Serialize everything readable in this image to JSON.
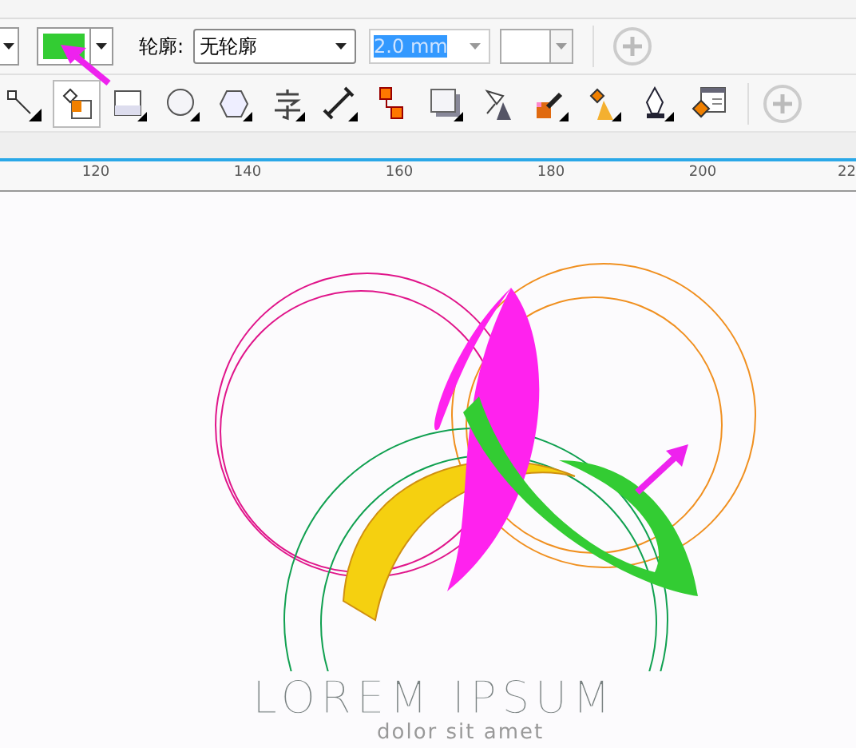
{
  "property_bar": {
    "fill_swatch": {
      "color": "#33cc33"
    },
    "outline_label": "轮廓:",
    "outline_select": "无轮廓",
    "width_field": "2.0 mm"
  },
  "toolbar": {
    "tools": [
      {
        "kind": "connector",
        "selected": false
      },
      {
        "kind": "smart-fill",
        "selected": true
      },
      {
        "kind": "rectangle",
        "selected": false
      },
      {
        "kind": "ellipse",
        "selected": false
      },
      {
        "kind": "polygon",
        "selected": false
      },
      {
        "kind": "text",
        "selected": false
      },
      {
        "kind": "dimension",
        "selected": false
      },
      {
        "kind": "link",
        "selected": false
      },
      {
        "kind": "shadow",
        "selected": false
      },
      {
        "kind": "transparency",
        "selected": false
      },
      {
        "kind": "eyedropper",
        "selected": false
      },
      {
        "kind": "fill",
        "selected": false
      },
      {
        "kind": "pen",
        "selected": false
      },
      {
        "kind": "properties",
        "selected": false
      }
    ]
  },
  "ruler": {
    "ticks": [
      "120",
      "140",
      "160",
      "180",
      "200",
      "22"
    ]
  },
  "canvas": {
    "title": "LOREM IPSUM",
    "subtitle": "dolor sit amet"
  }
}
